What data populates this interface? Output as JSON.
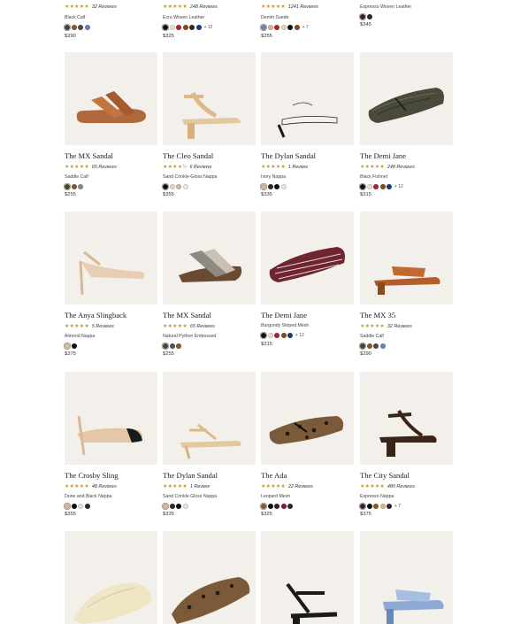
{
  "top_row": [
    {
      "stars": "★★★★★",
      "reviews": "32 Reviews",
      "material": "Black Calf",
      "swatches": [
        "#3b4f2d",
        "#8a5a2b",
        "#4a4a4a",
        "#6a86b2"
      ],
      "more": "",
      "price": "$290"
    },
    {
      "stars": "★★★★★",
      "reviews": "248 Reviews",
      "material": "Ecru Woven Leather",
      "swatches": [
        "#111111",
        "#e8e1d6",
        "#b2242a",
        "#8a4a1a",
        "#2b2b2b",
        "#1e3c78"
      ],
      "more": "+ 12",
      "price": "$325"
    },
    {
      "stars": "★★★★★",
      "reviews": "1241 Reviews",
      "material": "Denim Suede",
      "swatches": [
        "#6a86b2",
        "#d9b894",
        "#b2242a",
        "#e3d7c4",
        "#111111",
        "#8a4a1a"
      ],
      "more": "+ 7",
      "price": "$255"
    },
    {
      "stars": "",
      "reviews": "",
      "material": "Espresso Woven Leather",
      "swatches": [
        "#3a2418",
        "#2b2b2b"
      ],
      "more": "",
      "price": "$345"
    }
  ],
  "rows": [
    [
      {
        "name": "The MX Sandal",
        "stars": "★★★★★",
        "reviews": "65 Reviews",
        "material": "Saddle Calf",
        "swatches": [
          "#3b4f2d",
          "#8a5a2b",
          "#8c8c8c"
        ],
        "more": "",
        "price": "$255"
      },
      {
        "name": "The Cleo Sandal",
        "stars": "★★★★½",
        "reviews": "6 Reviews",
        "material": "Sand Crinkle-Gloss Nappa",
        "swatches": [
          "#111111",
          "#e8d8c8",
          "#d9b894",
          "#ece6dc"
        ],
        "more": "",
        "price": "$355"
      },
      {
        "name": "The Dylan Sandal",
        "stars": "★★★★★",
        "reviews": "1 Review",
        "material": "Ivory Nappa",
        "swatches": [
          "#d9b894",
          "#2b2b2b",
          "#111111",
          "#e6e6e6"
        ],
        "more": "",
        "price": "$335"
      },
      {
        "name": "The Demi Jane",
        "stars": "★★★★★",
        "reviews": "248 Reviews",
        "material": "Black Fishnet",
        "swatches": [
          "#111111",
          "#e8e1d6",
          "#b2242a",
          "#8a4a1a",
          "#1e3c78"
        ],
        "more": "+ 12",
        "price": "$315"
      }
    ],
    [
      {
        "name": "The Anya Slingback",
        "stars": "★★★★★",
        "reviews": "5 Reviews",
        "material": "Almond Nappa",
        "swatches": [
          "#d9c2a8",
          "#111111"
        ],
        "more": "",
        "price": "$375"
      },
      {
        "name": "The MX Sandal",
        "stars": "★★★★★",
        "reviews": "65 Reviews",
        "material": "Natural Python Embossed",
        "swatches": [
          "#3b4f2d",
          "#555555",
          "#8a5a2b"
        ],
        "more": "",
        "price": "$255"
      },
      {
        "name": "The Demi Jane",
        "stars": "",
        "reviews": "",
        "material": "Burgundy Striped Mesh",
        "swatches": [
          "#111111",
          "#e8e1d6",
          "#b2242a",
          "#8a4a1a",
          "#1e3c78"
        ],
        "more": "+ 12",
        "price": "$315"
      },
      {
        "name": "The MX 35",
        "stars": "★★★★★",
        "reviews": "32 Reviews",
        "material": "Saddle Calf",
        "swatches": [
          "#3b4f2d",
          "#8a5a2b",
          "#4a4a4a",
          "#6a86b2"
        ],
        "more": "",
        "price": "$290"
      }
    ],
    [
      {
        "name": "The Crosby Sling",
        "stars": "★★★★★",
        "reviews": "48 Reviews",
        "material": "Dune and Black Nappa",
        "swatches": [
          "#d9b894",
          "#111111",
          "#e8e1d6",
          "#2b2b2b"
        ],
        "more": "",
        "price": "$355"
      },
      {
        "name": "The Dylan Sandal",
        "stars": "★★★★★",
        "reviews": "1 Review",
        "material": "Sand Crinkle Gloss Nappa",
        "swatches": [
          "#d9b894",
          "#2b2b2b",
          "#111111",
          "#e6e6e6"
        ],
        "more": "",
        "price": "$335"
      },
      {
        "name": "The Ada",
        "stars": "★★★★★",
        "reviews": "22 Reviews",
        "material": "Leopard Mesh",
        "swatches": [
          "#8a5a2b",
          "#111111",
          "#3a2418",
          "#7a1f2b",
          "#2b2b2b"
        ],
        "more": "",
        "price": "$325"
      },
      {
        "name": "The City Sandal",
        "stars": "★★★★★",
        "reviews": "480 Reviews",
        "material": "Espresso Nappa",
        "swatches": [
          "#3a2418",
          "#111111",
          "#8a5a2b",
          "#d9b894",
          "#2b2b2b"
        ],
        "more": "+ 7",
        "price": "$375"
      }
    ]
  ],
  "bottom_row": [
    {
      "icon": "ballet-flat-cream-icon"
    },
    {
      "icon": "loafer-leopard-icon"
    },
    {
      "icon": "heel-black-icon"
    },
    {
      "icon": "sandal-blue-icon"
    }
  ],
  "colors": {
    "star": "#c69b2e",
    "tile_background": "#f3f0ec"
  }
}
